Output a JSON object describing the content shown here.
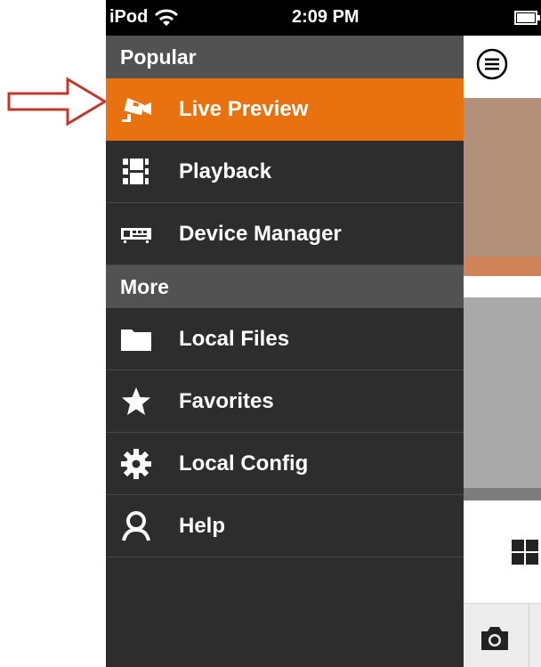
{
  "status_bar": {
    "carrier": "iPod",
    "time": "2:09 PM",
    "wifi_icon": "wifi-icon",
    "battery_icon": "battery-icon"
  },
  "drawer": {
    "sections": [
      {
        "title": "Popular",
        "items": [
          {
            "label": "Live Preview",
            "icon": "security-camera-icon",
            "active": true
          },
          {
            "label": "Playback",
            "icon": "film-strip-icon",
            "active": false
          },
          {
            "label": "Device Manager",
            "icon": "dvr-device-icon",
            "active": false
          }
        ]
      },
      {
        "title": "More",
        "items": [
          {
            "label": "Local Files",
            "icon": "folder-icon",
            "active": false
          },
          {
            "label": "Favorites",
            "icon": "star-icon",
            "active": false
          },
          {
            "label": "Local Config",
            "icon": "gear-icon",
            "active": false
          },
          {
            "label": "Help",
            "icon": "person-icon",
            "active": false
          }
        ]
      }
    ]
  },
  "main_panel": {
    "menu_icon": "hamburger-menu-icon",
    "grid_icon": "grid-layout-icon",
    "camera_icon": "camera-icon"
  },
  "colors": {
    "accent": "#e8720f",
    "drawer_background": "#2d2d2d",
    "section_header": "#525252",
    "annotation_arrow": "#c0392b"
  }
}
